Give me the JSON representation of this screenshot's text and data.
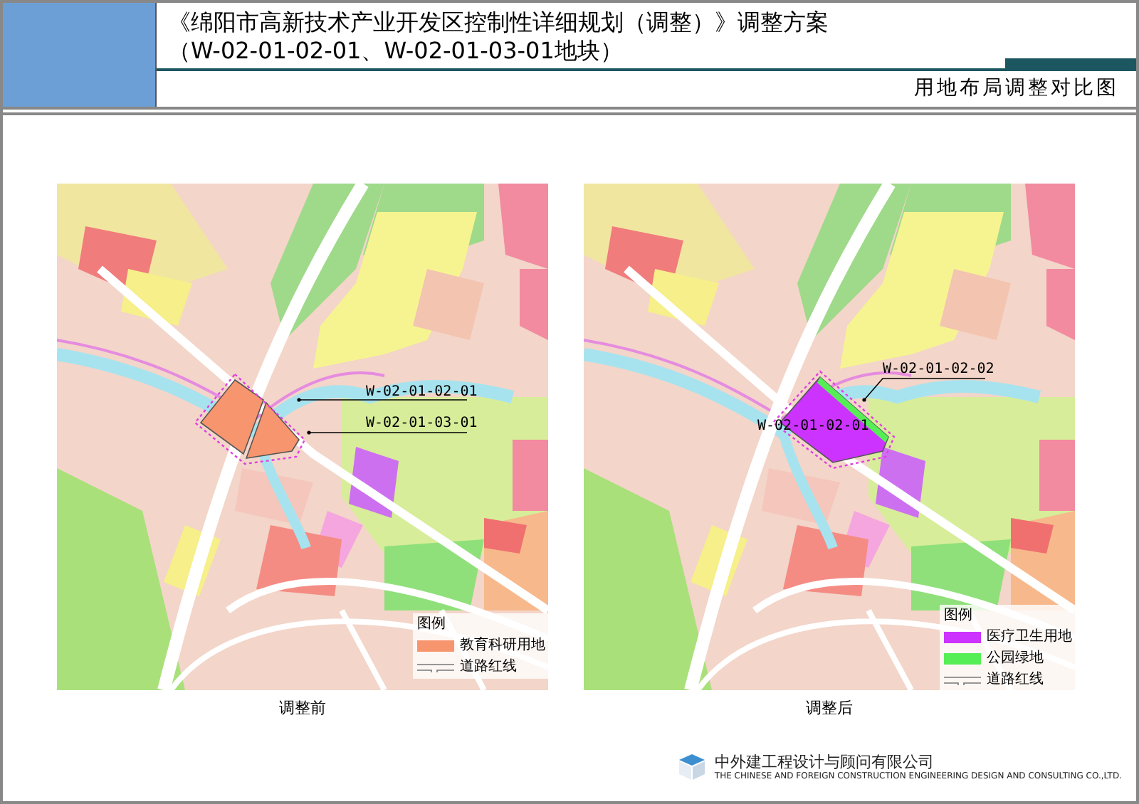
{
  "header": {
    "title": "《绵阳市高新技术产业开发区控制性详细规划（调整）》调整方案",
    "subtitle": "（W-02-01-02-01、W-02-01-03-01地块）",
    "sheet_title": "用地布局调整对比图"
  },
  "maps": [
    {
      "kind": "before",
      "caption": "调整前",
      "parcel_labels": [
        "W-02-01-02-01",
        "W-02-01-03-01"
      ],
      "legend": {
        "title": "图例",
        "items": [
          {
            "kind": "fill",
            "label": "教育科研用地",
            "color": "#f7956f"
          },
          {
            "kind": "line",
            "label": "道路红线"
          }
        ]
      }
    },
    {
      "kind": "after",
      "caption": "调整后",
      "parcel_labels": [
        "W-02-01-02-02",
        "W-02-01-02-01"
      ],
      "legend": {
        "title": "图例",
        "items": [
          {
            "kind": "fill",
            "label": "医疗卫生用地",
            "color": "#cc33ff"
          },
          {
            "kind": "fill",
            "label": "公园绿地",
            "color": "#55ee55"
          },
          {
            "kind": "line",
            "label": "道路红线"
          }
        ]
      }
    }
  ],
  "company": {
    "name": "中外建工程设计与顾问有限公司",
    "english": "THE CHINESE AND FOREIGN CONSTRUCTION ENGINEERING DESIGN AND CONSULTING CO.,LTD."
  }
}
